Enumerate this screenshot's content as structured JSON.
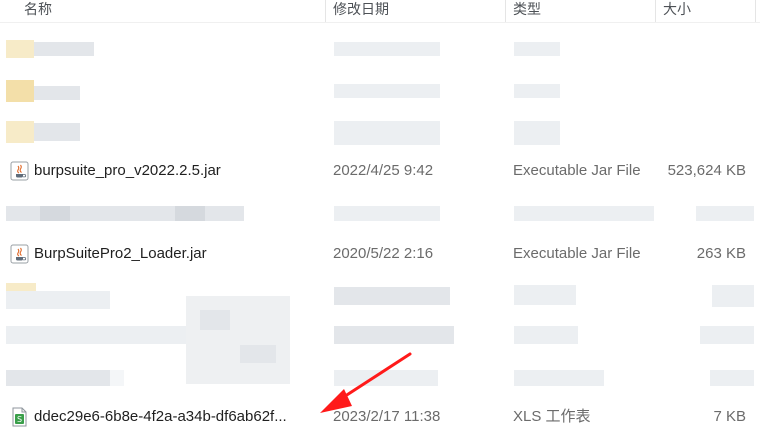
{
  "columns": {
    "name": "名称",
    "modified": "修改日期",
    "type": "类型",
    "size": "大小"
  },
  "files": [
    {
      "name": "burpsuite_pro_v2022.2.5.jar",
      "date": "2022/4/25 9:42",
      "type": "Executable Jar File",
      "size": "523,624 KB",
      "icon": "java-jar-icon"
    },
    {
      "name": "BurpSuitePro2_Loader.jar",
      "date": "2020/5/22 2:16",
      "type": "Executable Jar File",
      "size": "263 KB",
      "icon": "java-jar-icon"
    },
    {
      "name": "ddec29e6-6b8e-4f2a-a34b-df6ab62f...",
      "date": "2023/2/17 11:38",
      "type": "XLS 工作表",
      "size": "7 KB",
      "icon": "spreadsheet-icon"
    }
  ],
  "annotation": {
    "arrow_color": "#ff1a1a"
  }
}
